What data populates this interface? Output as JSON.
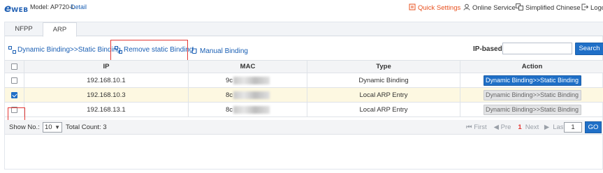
{
  "header": {
    "logo": "eWEB",
    "model": "Model: AP720-L",
    "detail_link": "Detail",
    "nav": {
      "quick_settings": "Quick Settings",
      "online_service": "Online Service",
      "language": "Simplified Chinese",
      "logout": "Logo"
    }
  },
  "tabs": [
    {
      "label": "NFPP",
      "active": false
    },
    {
      "label": "ARP",
      "active": true
    }
  ],
  "toolbar": {
    "bind_static": "Dynamic Binding>>Static Binding",
    "remove_static": "Remove static Binding",
    "manual_binding": "Manual Binding",
    "ip_based_label": "IP-based:",
    "ip_based_value": "",
    "search_label": "Search"
  },
  "table": {
    "columns": [
      "IP",
      "MAC",
      "Type",
      "Action"
    ],
    "rows": [
      {
        "ip": "192.168.10.1",
        "mac_prefix": "9c",
        "type": "Dynamic Binding",
        "action": "Dynamic Binding>>Static Binding",
        "checked": false,
        "action_enabled": true
      },
      {
        "ip": "192.168.10.3",
        "mac_prefix": "8c",
        "type": "Local ARP Entry",
        "action": "Dynamic Binding>>Static Binding",
        "checked": true,
        "action_enabled": false
      },
      {
        "ip": "192.168.13.1",
        "mac_prefix": "8c",
        "type": "Local ARP Entry",
        "action": "Dynamic Binding>>Static Binding",
        "checked": false,
        "action_enabled": false
      }
    ]
  },
  "footer": {
    "show_no_label": "Show No.:",
    "page_size": "10",
    "total_count": "Total Count: 3",
    "first": "First",
    "prev": "Pre",
    "current_page": "1",
    "next": "Next",
    "last": "Last",
    "goto_value": "1",
    "go_label": "GO"
  },
  "colors": {
    "accent": "#1f6fc7",
    "quick_settings": "#e8501e",
    "highlight": "#e53935"
  }
}
